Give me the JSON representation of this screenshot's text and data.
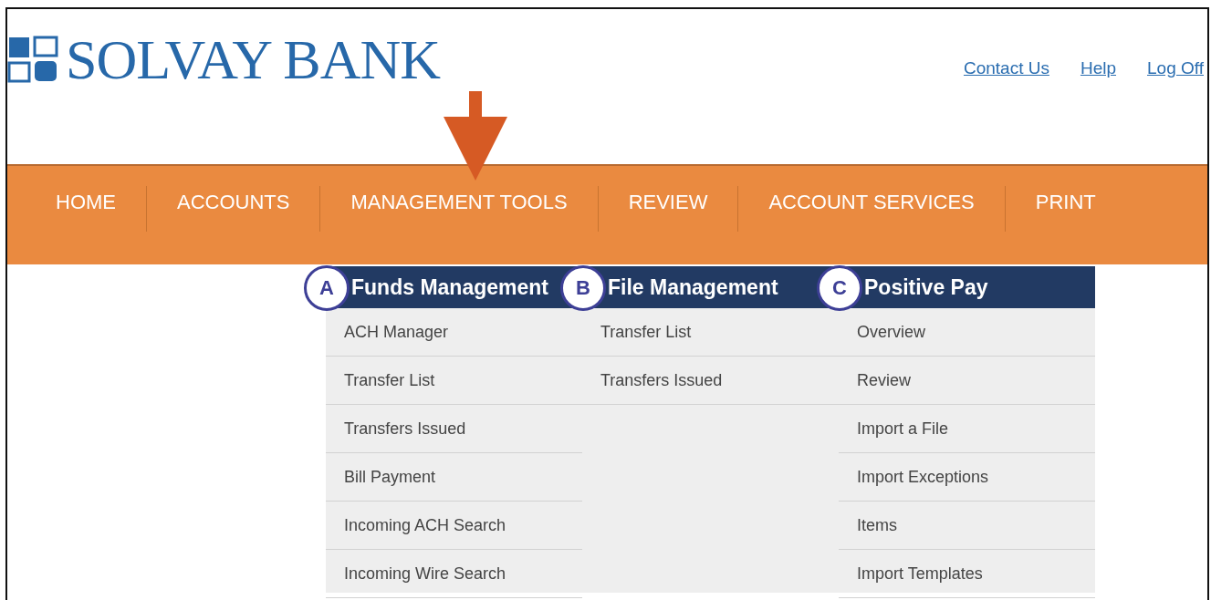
{
  "logo": {
    "text": "SOLVAY BANK"
  },
  "header_links": [
    "Contact Us",
    "Help",
    "Log Off"
  ],
  "nav": [
    "HOME",
    "ACCOUNTS",
    "MANAGEMENT TOOLS",
    "REVIEW",
    "ACCOUNT SERVICES",
    "PRINT"
  ],
  "menu_columns": [
    {
      "badge": "A",
      "title": "Funds Management",
      "items": [
        "ACH Manager",
        "Transfer List",
        "Transfers Issued",
        "Bill Payment",
        "Incoming ACH Search",
        "Incoming Wire Search"
      ]
    },
    {
      "badge": "B",
      "title": "File Management",
      "items": [
        "Transfer List",
        "Transfers Issued"
      ]
    },
    {
      "badge": "C",
      "title": "Positive Pay",
      "items": [
        "Overview",
        "Review",
        "Import a File",
        "Import Exceptions",
        "Items",
        "Import Templates"
      ]
    }
  ]
}
